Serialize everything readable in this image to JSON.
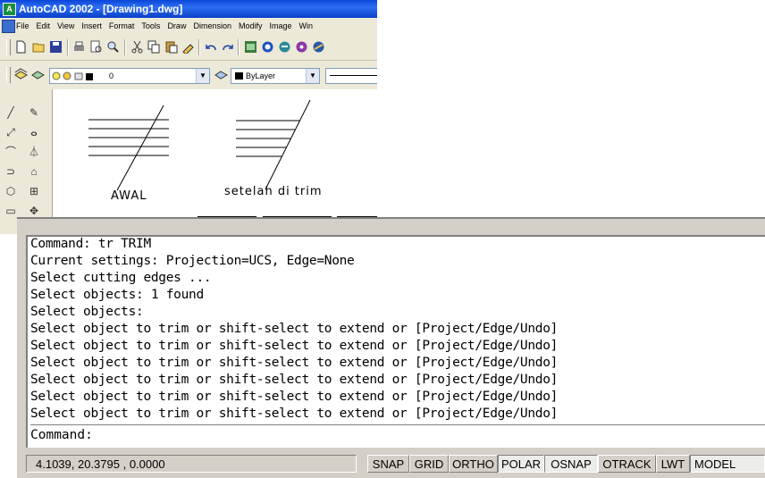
{
  "window": {
    "title": "AutoCAD 2002 - [Drawing1.dwg]"
  },
  "menu": [
    "File",
    "Edit",
    "View",
    "Insert",
    "Format",
    "Tools",
    "Draw",
    "Dimension",
    "Modify",
    "Image",
    "Win"
  ],
  "layer_combo": {
    "value": "0"
  },
  "linetype_combo": {
    "value": "ByLayer"
  },
  "drawing": {
    "label_left": "AWAL",
    "label_right": "setelah di trim"
  },
  "command_history": [
    "Command: tr TRIM",
    "Current settings: Projection=UCS, Edge=None",
    "Select cutting edges ...",
    "Select objects: 1 found",
    "Select objects:",
    "Select object to trim or shift-select to extend or [Project/Edge/Undo]",
    "Select object to trim or shift-select to extend or [Project/Edge/Undo]",
    "Select object to trim or shift-select to extend or [Project/Edge/Undo]",
    "Select object to trim or shift-select to extend or [Project/Edge/Undo]",
    "Select object to trim or shift-select to extend or [Project/Edge/Undo]",
    "Select object to trim or shift-select to extend or [Project/Edge/Undo]"
  ],
  "command_prompt": "Command:",
  "status": {
    "coordinates": "4.1039,  20.3795 , 0.0000",
    "buttons": [
      "SNAP",
      "GRID",
      "ORTHO",
      "POLAR",
      "OSNAP",
      "OTRACK",
      "LWT",
      "MODEL"
    ]
  },
  "colors": {
    "title_bar": "#0a46d8",
    "accent_icon": "#1b8f3e"
  }
}
